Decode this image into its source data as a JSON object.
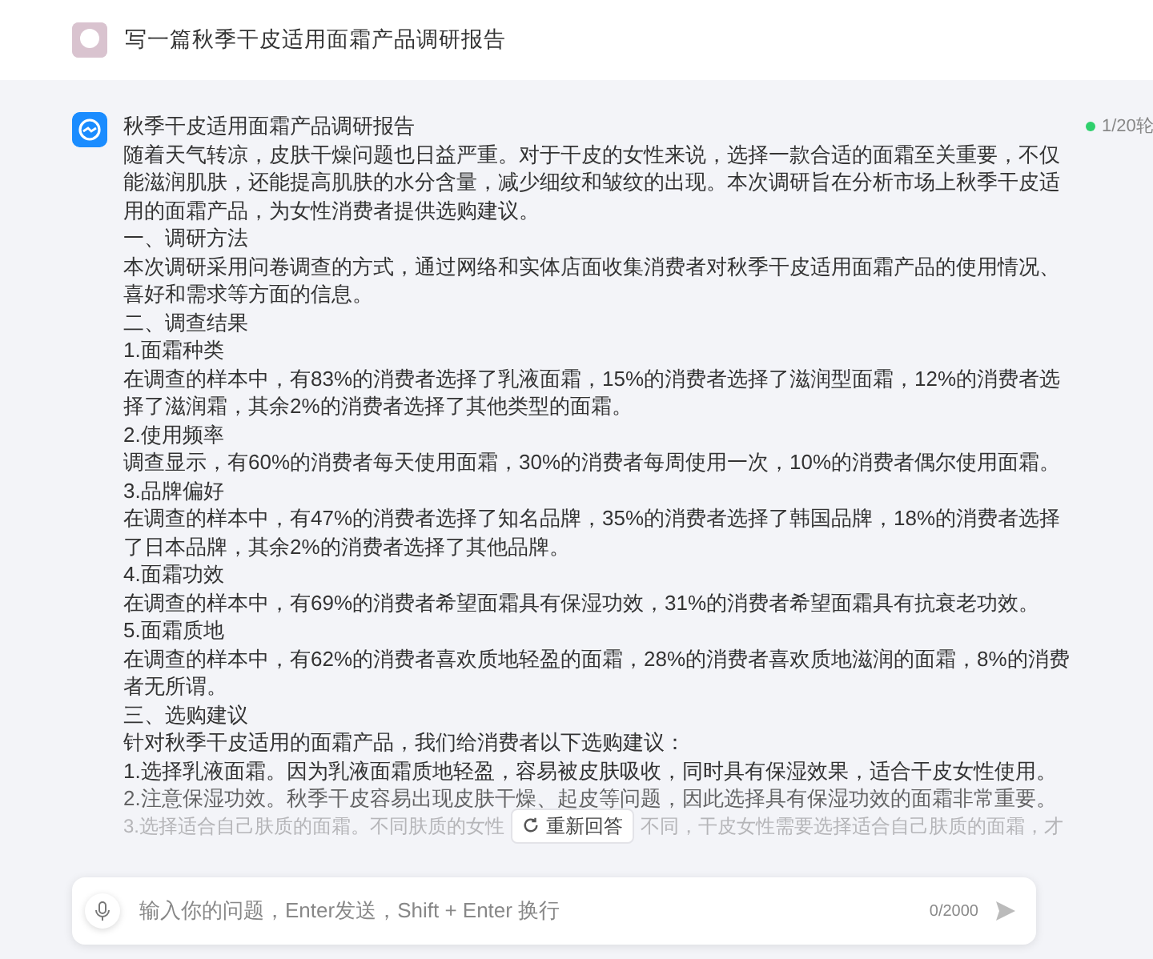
{
  "header": {
    "title": "写一篇秋季干皮适用面霜产品调研报告"
  },
  "answer": {
    "title": "秋季干皮适用面霜产品调研报告",
    "paragraphs": [
      "随着天气转凉，皮肤干燥问题也日益严重。对于干皮的女性来说，选择一款合适的面霜至关重要，不仅能滋润肌肤，还能提高肌肤的水分含量，减少细纹和皱纹的出现。本次调研旨在分析市场上秋季干皮适用的面霜产品，为女性消费者提供选购建议。",
      "一、调研方法",
      "本次调研采用问卷调查的方式，通过网络和实体店面收集消费者对秋季干皮适用面霜产品的使用情况、喜好和需求等方面的信息。",
      "二、调查结果",
      "1.面霜种类",
      "在调查的样本中，有83%的消费者选择了乳液面霜，15%的消费者选择了滋润型面霜，12%的消费者选择了滋润霜，其余2%的消费者选择了其他类型的面霜。",
      "2.使用频率",
      "调查显示，有60%的消费者每天使用面霜，30%的消费者每周使用一次，10%的消费者偶尔使用面霜。",
      "3.品牌偏好",
      "在调查的样本中，有47%的消费者选择了知名品牌，35%的消费者选择了韩国品牌，18%的消费者选择了日本品牌，其余2%的消费者选择了其他品牌。",
      "4.面霜功效",
      "在调查的样本中，有69%的消费者希望面霜具有保湿功效，31%的消费者希望面霜具有抗衰老功效。",
      "5.面霜质地",
      "在调查的样本中，有62%的消费者喜欢质地轻盈的面霜，28%的消费者喜欢质地滋润的面霜，8%的消费者无所谓。",
      "三、选购建议",
      "针对秋季干皮适用的面霜产品，我们给消费者以下选购建议：",
      "1.选择乳液面霜。因为乳液面霜质地轻盈，容易被皮肤吸收，同时具有保湿效果，适合干皮女性使用。",
      "2.注意保湿功效。秋季干皮容易出现皮肤干燥、起皮等问题，因此选择具有保湿功效的面霜非常重要。"
    ],
    "last_line": {
      "left": "3.选择适合自己肤质的面霜。不同肤质的女性",
      "right": "不同，干皮女性需要选择适合自己肤质的面霜，才"
    },
    "turns": "1/20轮",
    "regenerate": "重新回答"
  },
  "input": {
    "placeholder": "输入你的问题，Enter发送，Shift + Enter 换行",
    "counter": "0/2000"
  }
}
